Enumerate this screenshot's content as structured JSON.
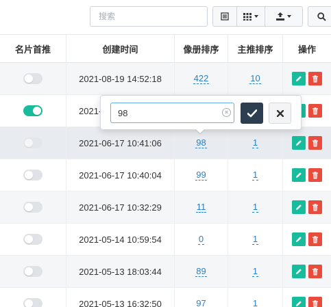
{
  "toolbar": {
    "search_placeholder": "搜索"
  },
  "columns": [
    "名片首推",
    "创建时间",
    "像册排序",
    "主推排序",
    "操作"
  ],
  "rows": [
    {
      "toggle_on": false,
      "created": "2021-08-19 14:52:18",
      "album_sort": "422",
      "main_sort": "10"
    },
    {
      "toggle_on": true,
      "created": "2021-",
      "album_sort": "",
      "main_sort": ""
    },
    {
      "toggle_on": false,
      "created": "2021-06-17 10:41:06",
      "album_sort": "98",
      "main_sort": "1"
    },
    {
      "toggle_on": false,
      "created": "2021-06-17 10:40:04",
      "album_sort": "99",
      "main_sort": "1"
    },
    {
      "toggle_on": false,
      "created": "2021-06-17 10:32:29",
      "album_sort": "11",
      "main_sort": "1"
    },
    {
      "toggle_on": false,
      "created": "2021-05-14 10:59:54",
      "album_sort": "0",
      "main_sort": "1"
    },
    {
      "toggle_on": false,
      "created": "2021-05-13 18:03:44",
      "album_sort": "89",
      "main_sort": "1"
    },
    {
      "toggle_on": false,
      "created": "2021-05-13 16:32:50",
      "album_sort": "97",
      "main_sort": "1"
    }
  ],
  "popover": {
    "value": "98"
  },
  "colors": {
    "accent_green": "#18bc9c",
    "danger_red": "#e74c3c",
    "primary_dark": "#2c3e50",
    "link_blue": "#2c7fc2"
  },
  "icons": {
    "toolbar": [
      "list-view-icon",
      "grid-columns-icon",
      "export-icon",
      "search-icon"
    ],
    "row_actions": [
      "pencil-icon",
      "trash-icon"
    ],
    "popover": [
      "clear-icon",
      "check-icon",
      "close-icon"
    ]
  }
}
